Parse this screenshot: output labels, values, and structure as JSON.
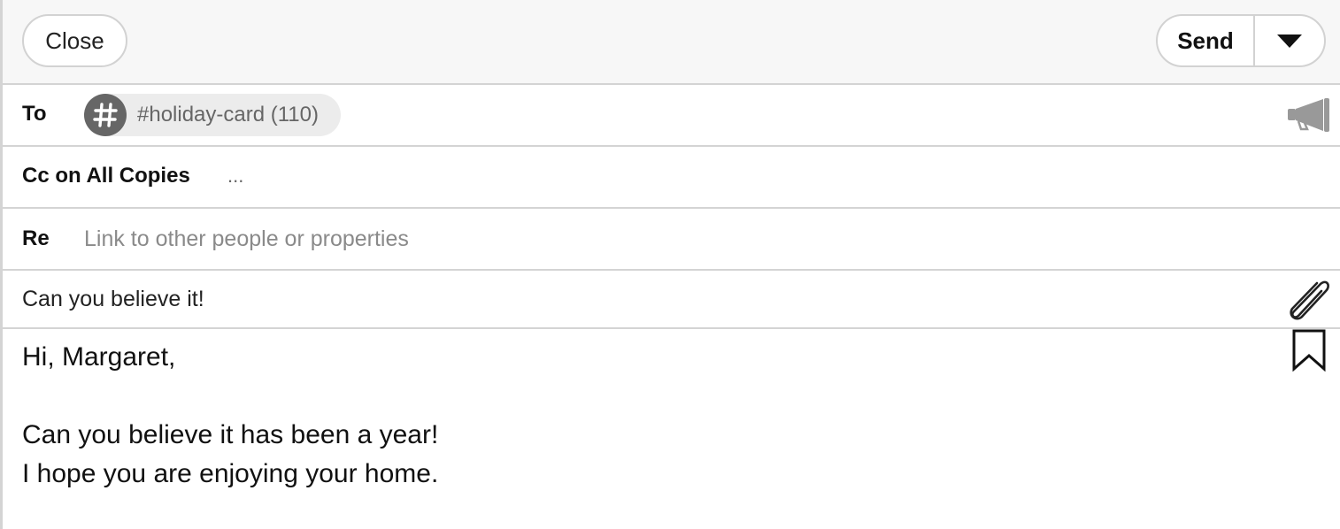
{
  "toolbar": {
    "close_label": "Close",
    "send_label": "Send",
    "send_menu_icon": "caret-down-icon"
  },
  "to": {
    "label": "To",
    "chip": {
      "icon": "hashtag-icon",
      "text": "#holiday-card (110)"
    },
    "broadcast_icon": "megaphone-icon"
  },
  "cc": {
    "label": "Cc on All Copies",
    "value": "..."
  },
  "re": {
    "label": "Re",
    "placeholder": "Link to other people or properties",
    "value": ""
  },
  "subject": {
    "value": "Can you believe it!",
    "attach_icon": "paperclip-icon"
  },
  "body": {
    "lines": [
      "Hi, Margaret,",
      "",
      "Can you believe it has been a year!",
      "I hope you are enjoying your home."
    ],
    "template_icon": "bookmark-icon"
  },
  "colors": {
    "border": "#d4d4d4",
    "toolbar_bg": "#f7f7f7",
    "chip_bg": "#ececec",
    "chip_avatar": "#666666",
    "placeholder": "#8a8a8a"
  }
}
